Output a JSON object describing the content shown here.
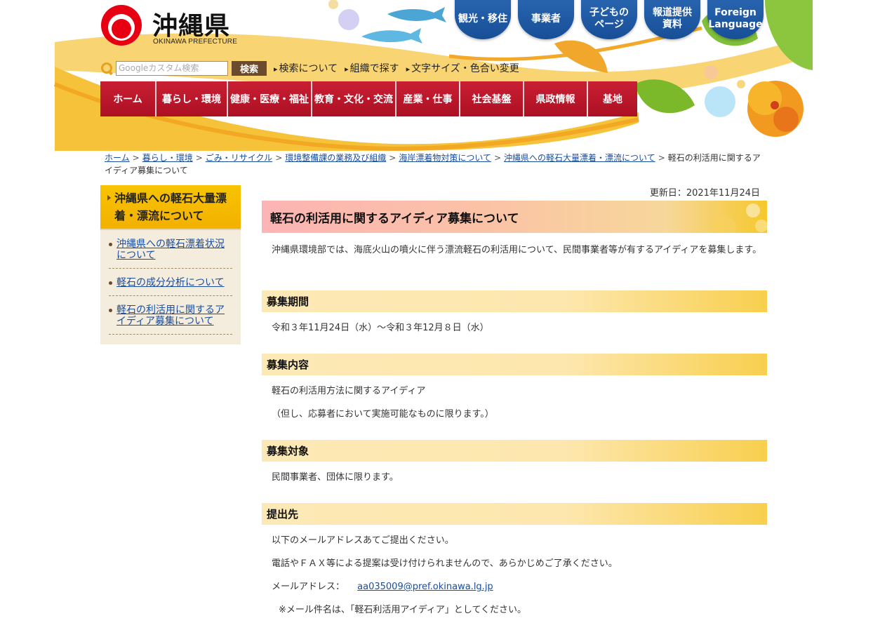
{
  "header": {
    "logo_title": "沖縄県",
    "logo_subtitle": "OKINAWA PREFECTURE",
    "top_links": [
      "観光・移住",
      "事業者",
      "子どもの\nページ",
      "報道提供\n資料",
      "Foreign\nLanguage"
    ],
    "search": {
      "placeholder": "Googleカスタム検索",
      "button_label": "検索"
    },
    "util_links": [
      "検索について",
      "組織で探す",
      "文字サイズ・色合い変更"
    ],
    "global_nav": [
      "ホーム",
      "暮らし・環境",
      "健康・医療・福祉",
      "教育・文化・交流",
      "産業・仕事",
      "社会基盤",
      "県政情報",
      "基地"
    ],
    "colors": {
      "nav_red": "#c91f33",
      "accent_yellow": "#f5c82c",
      "link_blue": "#1a4ea0",
      "top_link_blue": "#1f5aa6"
    }
  },
  "breadcrumb": {
    "links": [
      "ホーム",
      "暮らし・環境",
      "ごみ・リサイクル",
      "環境整備課の業務及び組織",
      "海岸漂着物対策について",
      "沖縄県への軽石大量漂着・漂流について"
    ],
    "current": "軽石の利活用に関するアイディア募集について",
    "separator": ">"
  },
  "sidebar": {
    "heading": "沖縄県への軽石大量漂着・漂流について",
    "items": [
      "沖縄県への軽石漂着状況について",
      "軽石の成分分析について",
      "軽石の利活用に関するアイディア募集について"
    ]
  },
  "main": {
    "updated": "更新日：2021年11月24日",
    "title": "軽石の利活用に関するアイディア募集について",
    "intro": "沖縄県環境部では、海底火山の噴火に伴う漂流軽石の利活用について、民間事業者等が有するアイディアを募集します。",
    "sections": [
      {
        "heading": "募集期間",
        "lines": [
          "令和３年11月24日（水）～令和３年12月８日（水）"
        ]
      },
      {
        "heading": "募集内容",
        "lines": [
          "軽石の利活用方法に関するアイディア",
          "（但し、応募者において実施可能なものに限ります。）"
        ]
      },
      {
        "heading": "募集対象",
        "lines": [
          "民間事業者、団体に限ります。"
        ]
      },
      {
        "heading": "提出先",
        "lines": [
          "以下のメールアドレスあてご提出ください。",
          "電話やＦＡＸ等による提案は受け付けられませんので、あらかじめご了承ください。"
        ],
        "email_label": "メールアドレス：",
        "email": "aa035009@pref.okinawa.lg.jp",
        "note": "※メール件名は、「軽石利活用アイディア」としてください。"
      }
    ]
  }
}
